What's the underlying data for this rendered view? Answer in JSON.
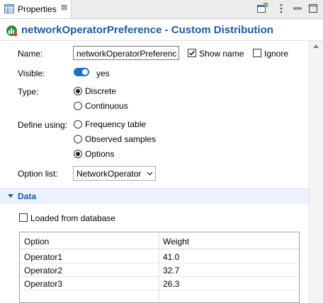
{
  "tab": {
    "label": "Properties",
    "close": "⊠"
  },
  "title": {
    "text": "networkOperatorPreference - Custom Distribution"
  },
  "form": {
    "name_label": "Name:",
    "name_value": "networkOperatorPreferenc",
    "show_name_label": "Show name",
    "ignore_label": "Ignore",
    "visible_label": "Visible:",
    "visible_value": "yes",
    "type_label": "Type:",
    "type_options": [
      "Discrete",
      "Continuous"
    ],
    "define_label": "Define using:",
    "define_options": [
      "Frequency table",
      "Observed samples",
      "Options"
    ],
    "option_list_label": "Option list:",
    "option_list_value": "NetworkOperator"
  },
  "data_section": {
    "title": "Data",
    "loaded_label": "Loaded from database"
  },
  "table": {
    "headers": [
      "Option",
      "Weight"
    ],
    "rows": [
      [
        "Operator1",
        "41.0"
      ],
      [
        "Operator2",
        "32.7"
      ],
      [
        "Operator3",
        "26.3"
      ]
    ]
  },
  "colors": {
    "accent": "#1d5aa8",
    "toggle": "#1f6fc5"
  }
}
